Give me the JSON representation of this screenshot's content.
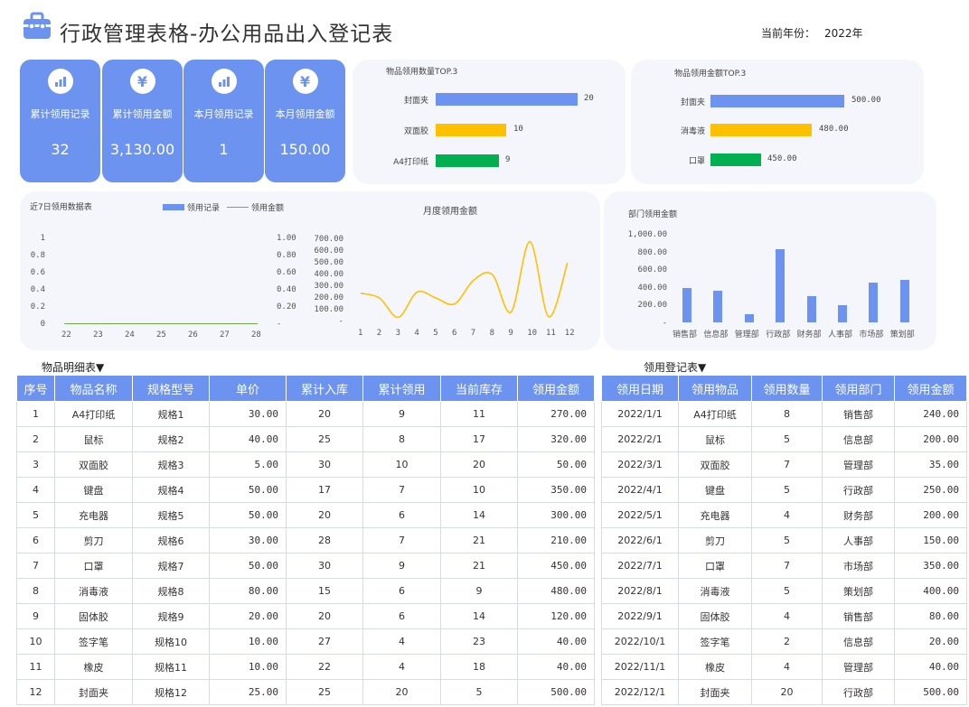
{
  "header": {
    "title": "行政管理表格-办公用品出入登记表",
    "year_label": "当前年份：",
    "year_value": "2022年"
  },
  "cards": [
    {
      "icon": "bar-chart-icon",
      "label": "累计领用记录",
      "value": "32"
    },
    {
      "icon": "yen-icon",
      "label": "累计领用金额",
      "value": "3,130.00"
    },
    {
      "icon": "bar-chart-icon",
      "label": "本月领用记录",
      "value": "1"
    },
    {
      "icon": "yen-icon",
      "label": "本月领用金额",
      "value": "150.00"
    }
  ],
  "top_qty": {
    "title": "物品领用数量TOP.3",
    "items": [
      {
        "label": "封面夹",
        "value": "20",
        "color": "#6b93ef"
      },
      {
        "label": "双面胶",
        "value": "10",
        "color": "#ffc000"
      },
      {
        "label": "A4打印纸",
        "value": "9",
        "color": "#00b050"
      }
    ]
  },
  "top_amount": {
    "title": "物品领用金额TOP.3",
    "items": [
      {
        "label": "封面夹",
        "value": "500.00",
        "color": "#6b93ef"
      },
      {
        "label": "消毒液",
        "value": "480.00",
        "color": "#ffc000"
      },
      {
        "label": "口罩",
        "value": "450.00",
        "color": "#00b050"
      }
    ]
  },
  "week_chart": {
    "title": "近7日领用数据表",
    "legend": [
      "领用记录",
      "领用金额"
    ],
    "left_ticks": [
      "1",
      "0.8",
      "0.6",
      "0.4",
      "0.2",
      "0"
    ],
    "right_ticks": [
      "1.00",
      "0.80",
      "0.60",
      "0.40",
      "0.20",
      "-"
    ],
    "x_ticks": [
      "22",
      "23",
      "24",
      "25",
      "26",
      "27",
      "28"
    ]
  },
  "month_chart": {
    "title": "月度领用金额",
    "y_ticks": [
      "700.00",
      "600.00",
      "500.00",
      "400.00",
      "300.00",
      "200.00",
      "100.00",
      "-"
    ],
    "x_ticks": [
      "1",
      "2",
      "3",
      "4",
      "5",
      "6",
      "7",
      "8",
      "9",
      "10",
      "11",
      "12"
    ]
  },
  "dept_chart": {
    "title": "部门领用金额",
    "y_ticks": [
      "1,000.00",
      "800.00",
      "600.00",
      "400.00",
      "200.00",
      "-"
    ],
    "categories": [
      "销售部",
      "信息部",
      "管理部",
      "行政部",
      "财务部",
      "人事部",
      "市场部",
      "策划部"
    ]
  },
  "chart_data": [
    {
      "type": "line",
      "title": "近7日领用数据表",
      "x": [
        "22",
        "23",
        "24",
        "25",
        "26",
        "27",
        "28"
      ],
      "series": [
        {
          "name": "领用记录",
          "values": [
            0,
            0,
            0,
            0,
            0,
            0,
            0
          ]
        },
        {
          "name": "领用金额",
          "values": [
            0,
            0,
            0,
            0,
            0,
            0,
            0
          ]
        }
      ],
      "ylim": [
        0,
        1
      ]
    },
    {
      "type": "line",
      "title": "月度领用金额",
      "x": [
        1,
        2,
        3,
        4,
        5,
        6,
        7,
        8,
        9,
        10,
        11,
        12
      ],
      "series": [
        {
          "values": [
            240,
            200,
            35,
            250,
            200,
            150,
            350,
            400,
            80,
            680,
            40,
            500
          ]
        }
      ],
      "ylim": [
        0,
        700
      ]
    },
    {
      "type": "bar",
      "title": "部门领用金额",
      "categories": [
        "销售部",
        "信息部",
        "管理部",
        "行政部",
        "财务部",
        "人事部",
        "市场部",
        "策划部"
      ],
      "values": [
        390,
        360,
        90,
        840,
        300,
        200,
        450,
        480
      ],
      "ylim": [
        0,
        1000
      ]
    }
  ],
  "items_table": {
    "title": "物品明细表▼",
    "columns": [
      "序号",
      "物品名称",
      "规格型号",
      "单价",
      "累计入库",
      "累计领用",
      "当前库存",
      "领用金额"
    ],
    "rows": [
      [
        "1",
        "A4打印纸",
        "规格1",
        "30.00",
        "20",
        "9",
        "11",
        "270.00"
      ],
      [
        "2",
        "鼠标",
        "规格2",
        "40.00",
        "25",
        "8",
        "17",
        "320.00"
      ],
      [
        "3",
        "双面胶",
        "规格3",
        "5.00",
        "30",
        "10",
        "20",
        "50.00"
      ],
      [
        "4",
        "键盘",
        "规格4",
        "50.00",
        "17",
        "7",
        "10",
        "350.00"
      ],
      [
        "5",
        "充电器",
        "规格5",
        "50.00",
        "20",
        "6",
        "14",
        "300.00"
      ],
      [
        "6",
        "剪刀",
        "规格6",
        "30.00",
        "28",
        "7",
        "21",
        "210.00"
      ],
      [
        "7",
        "口罩",
        "规格7",
        "50.00",
        "30",
        "9",
        "21",
        "450.00"
      ],
      [
        "8",
        "消毒液",
        "规格8",
        "80.00",
        "15",
        "6",
        "9",
        "480.00"
      ],
      [
        "9",
        "固体胶",
        "规格9",
        "20.00",
        "20",
        "6",
        "14",
        "120.00"
      ],
      [
        "10",
        "签字笔",
        "规格10",
        "10.00",
        "27",
        "4",
        "23",
        "40.00"
      ],
      [
        "11",
        "橡皮",
        "规格11",
        "10.00",
        "22",
        "4",
        "18",
        "40.00"
      ],
      [
        "12",
        "封面夹",
        "规格12",
        "25.00",
        "25",
        "20",
        "5",
        "500.00"
      ]
    ]
  },
  "log_table": {
    "title": "领用登记表▼",
    "columns": [
      "领用日期",
      "领用物品",
      "领用数量",
      "领用部门",
      "领用金额"
    ],
    "rows": [
      [
        "2022/1/1",
        "A4打印纸",
        "8",
        "销售部",
        "240.00"
      ],
      [
        "2022/2/1",
        "鼠标",
        "5",
        "信息部",
        "200.00"
      ],
      [
        "2022/3/1",
        "双面胶",
        "7",
        "管理部",
        "35.00"
      ],
      [
        "2022/4/1",
        "键盘",
        "5",
        "行政部",
        "250.00"
      ],
      [
        "2022/5/1",
        "充电器",
        "4",
        "财务部",
        "200.00"
      ],
      [
        "2022/6/1",
        "剪刀",
        "5",
        "人事部",
        "150.00"
      ],
      [
        "2022/7/1",
        "口罩",
        "7",
        "市场部",
        "350.00"
      ],
      [
        "2022/8/1",
        "消毒液",
        "5",
        "策划部",
        "400.00"
      ],
      [
        "2022/9/1",
        "固体胶",
        "4",
        "销售部",
        "80.00"
      ],
      [
        "2022/10/1",
        "签字笔",
        "2",
        "信息部",
        "20.00"
      ],
      [
        "2022/11/1",
        "橡皮",
        "4",
        "管理部",
        "40.00"
      ],
      [
        "2022/12/1",
        "封面夹",
        "20",
        "行政部",
        "500.00"
      ]
    ]
  }
}
